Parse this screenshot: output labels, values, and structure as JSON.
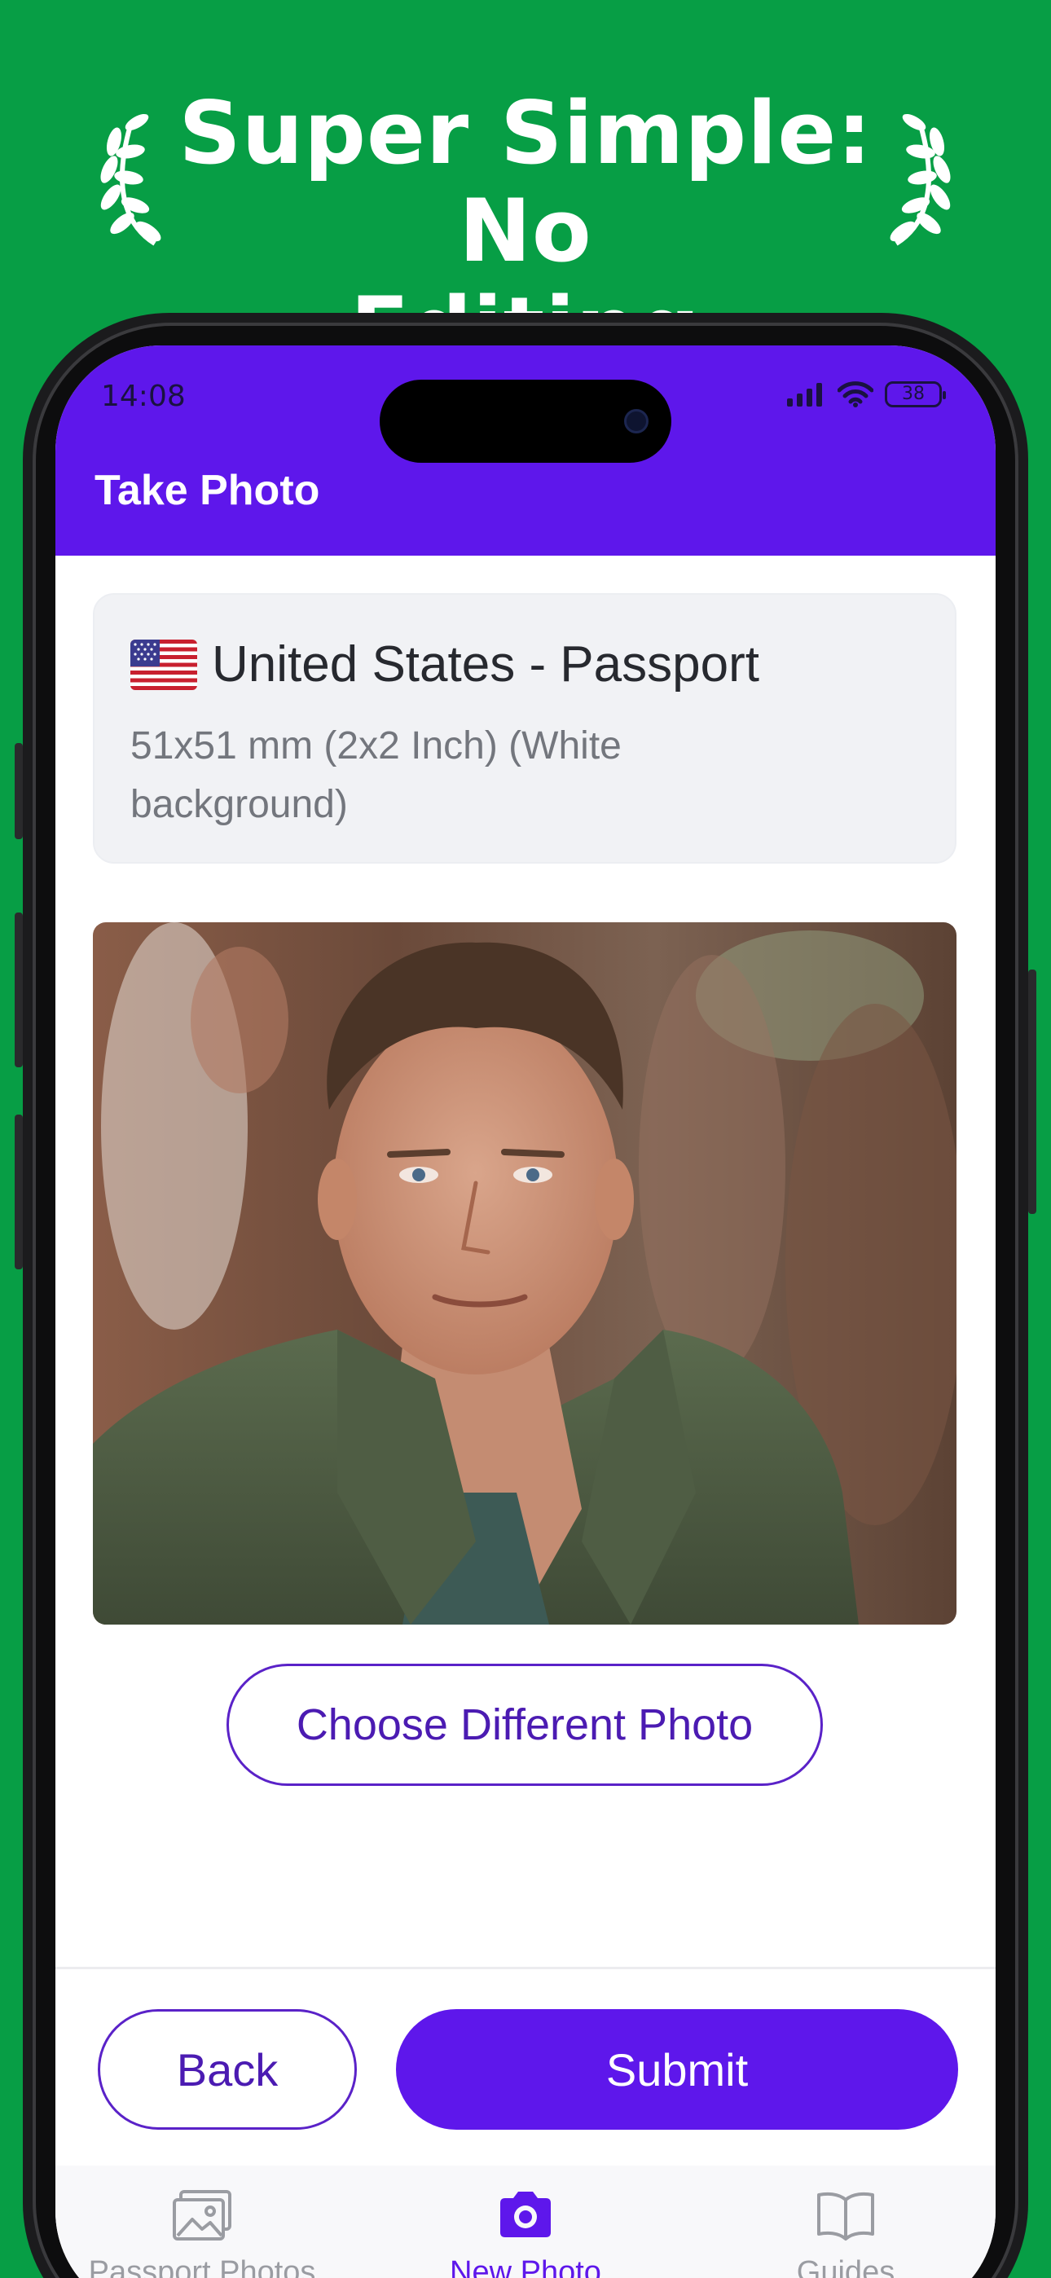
{
  "promo": {
    "headline_line1": "Super Simple: No",
    "headline_line2": "Editing Needed"
  },
  "status_bar": {
    "time": "14:08",
    "battery": "38"
  },
  "header": {
    "title": "Take Photo"
  },
  "document": {
    "title": "United States - Passport",
    "size": "51x51 mm (2x2 Inch) (White background)"
  },
  "actions": {
    "choose_label": "Choose Different Photo",
    "back_label": "Back",
    "submit_label": "Submit"
  },
  "tabs": [
    {
      "label": "Passport Photos",
      "icon": "image-icon",
      "active": false
    },
    {
      "label": "New Photo",
      "icon": "camera-icon",
      "active": true
    },
    {
      "label": "Guides",
      "icon": "book-icon",
      "active": false
    }
  ],
  "colors": {
    "promo_bg": "#079e45",
    "accent": "#5e17eb",
    "card_bg": "#f1f2f5"
  }
}
